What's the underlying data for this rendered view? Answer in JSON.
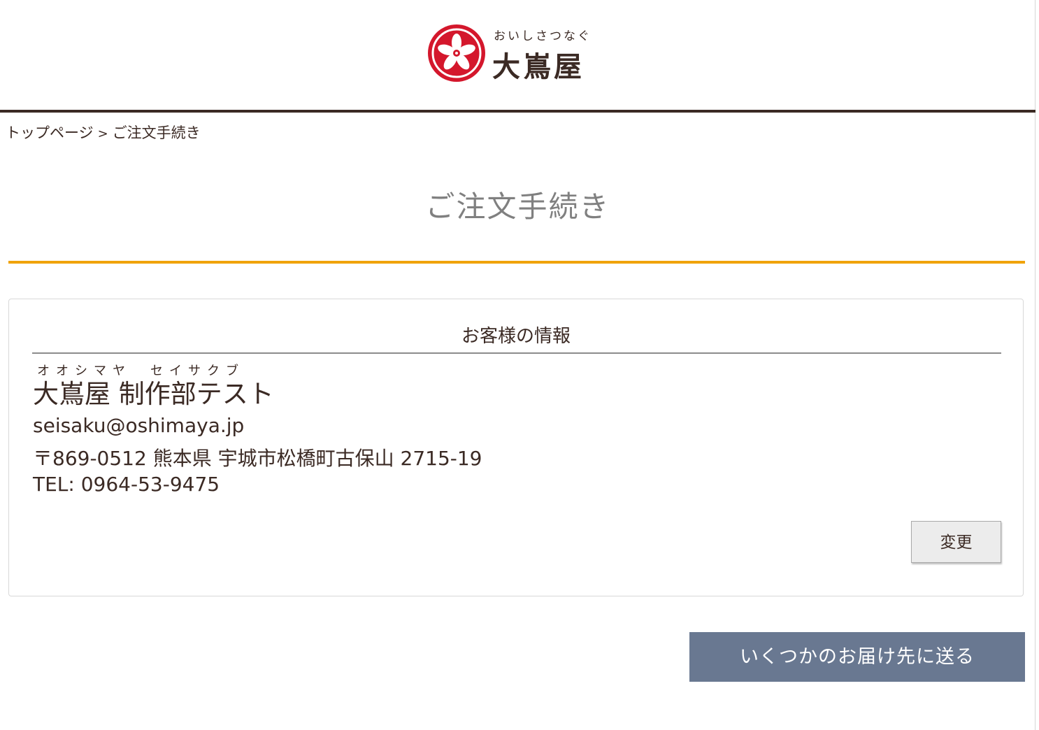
{
  "brand": {
    "tagline": "おいしさつなぐ",
    "name": "大嶌屋",
    "mark_icon": "five-petal-flower-crest-icon",
    "colors": {
      "brand_red": "#d4172c",
      "dark_brown": "#3b2a24",
      "accent_orange": "#f0a30a",
      "button_slate": "#697891"
    }
  },
  "breadcrumb": {
    "home": "トップページ",
    "separator": ">",
    "current": "ご注文手続き"
  },
  "page": {
    "title": "ご注文手続き"
  },
  "customer_card": {
    "title": "お客様の情報",
    "furigana": "オオシマヤ　セイサクブ",
    "name": "大嶌屋 制作部テスト",
    "email": "seisaku@oshimaya.jp",
    "address": "〒869-0512 熊本県 宇城市松橋町古保山 2715-19",
    "tel": "TEL: 0964-53-9475",
    "change_label": "変更"
  },
  "actions": {
    "multi_ship_label": "いくつかのお届け先に送る"
  }
}
